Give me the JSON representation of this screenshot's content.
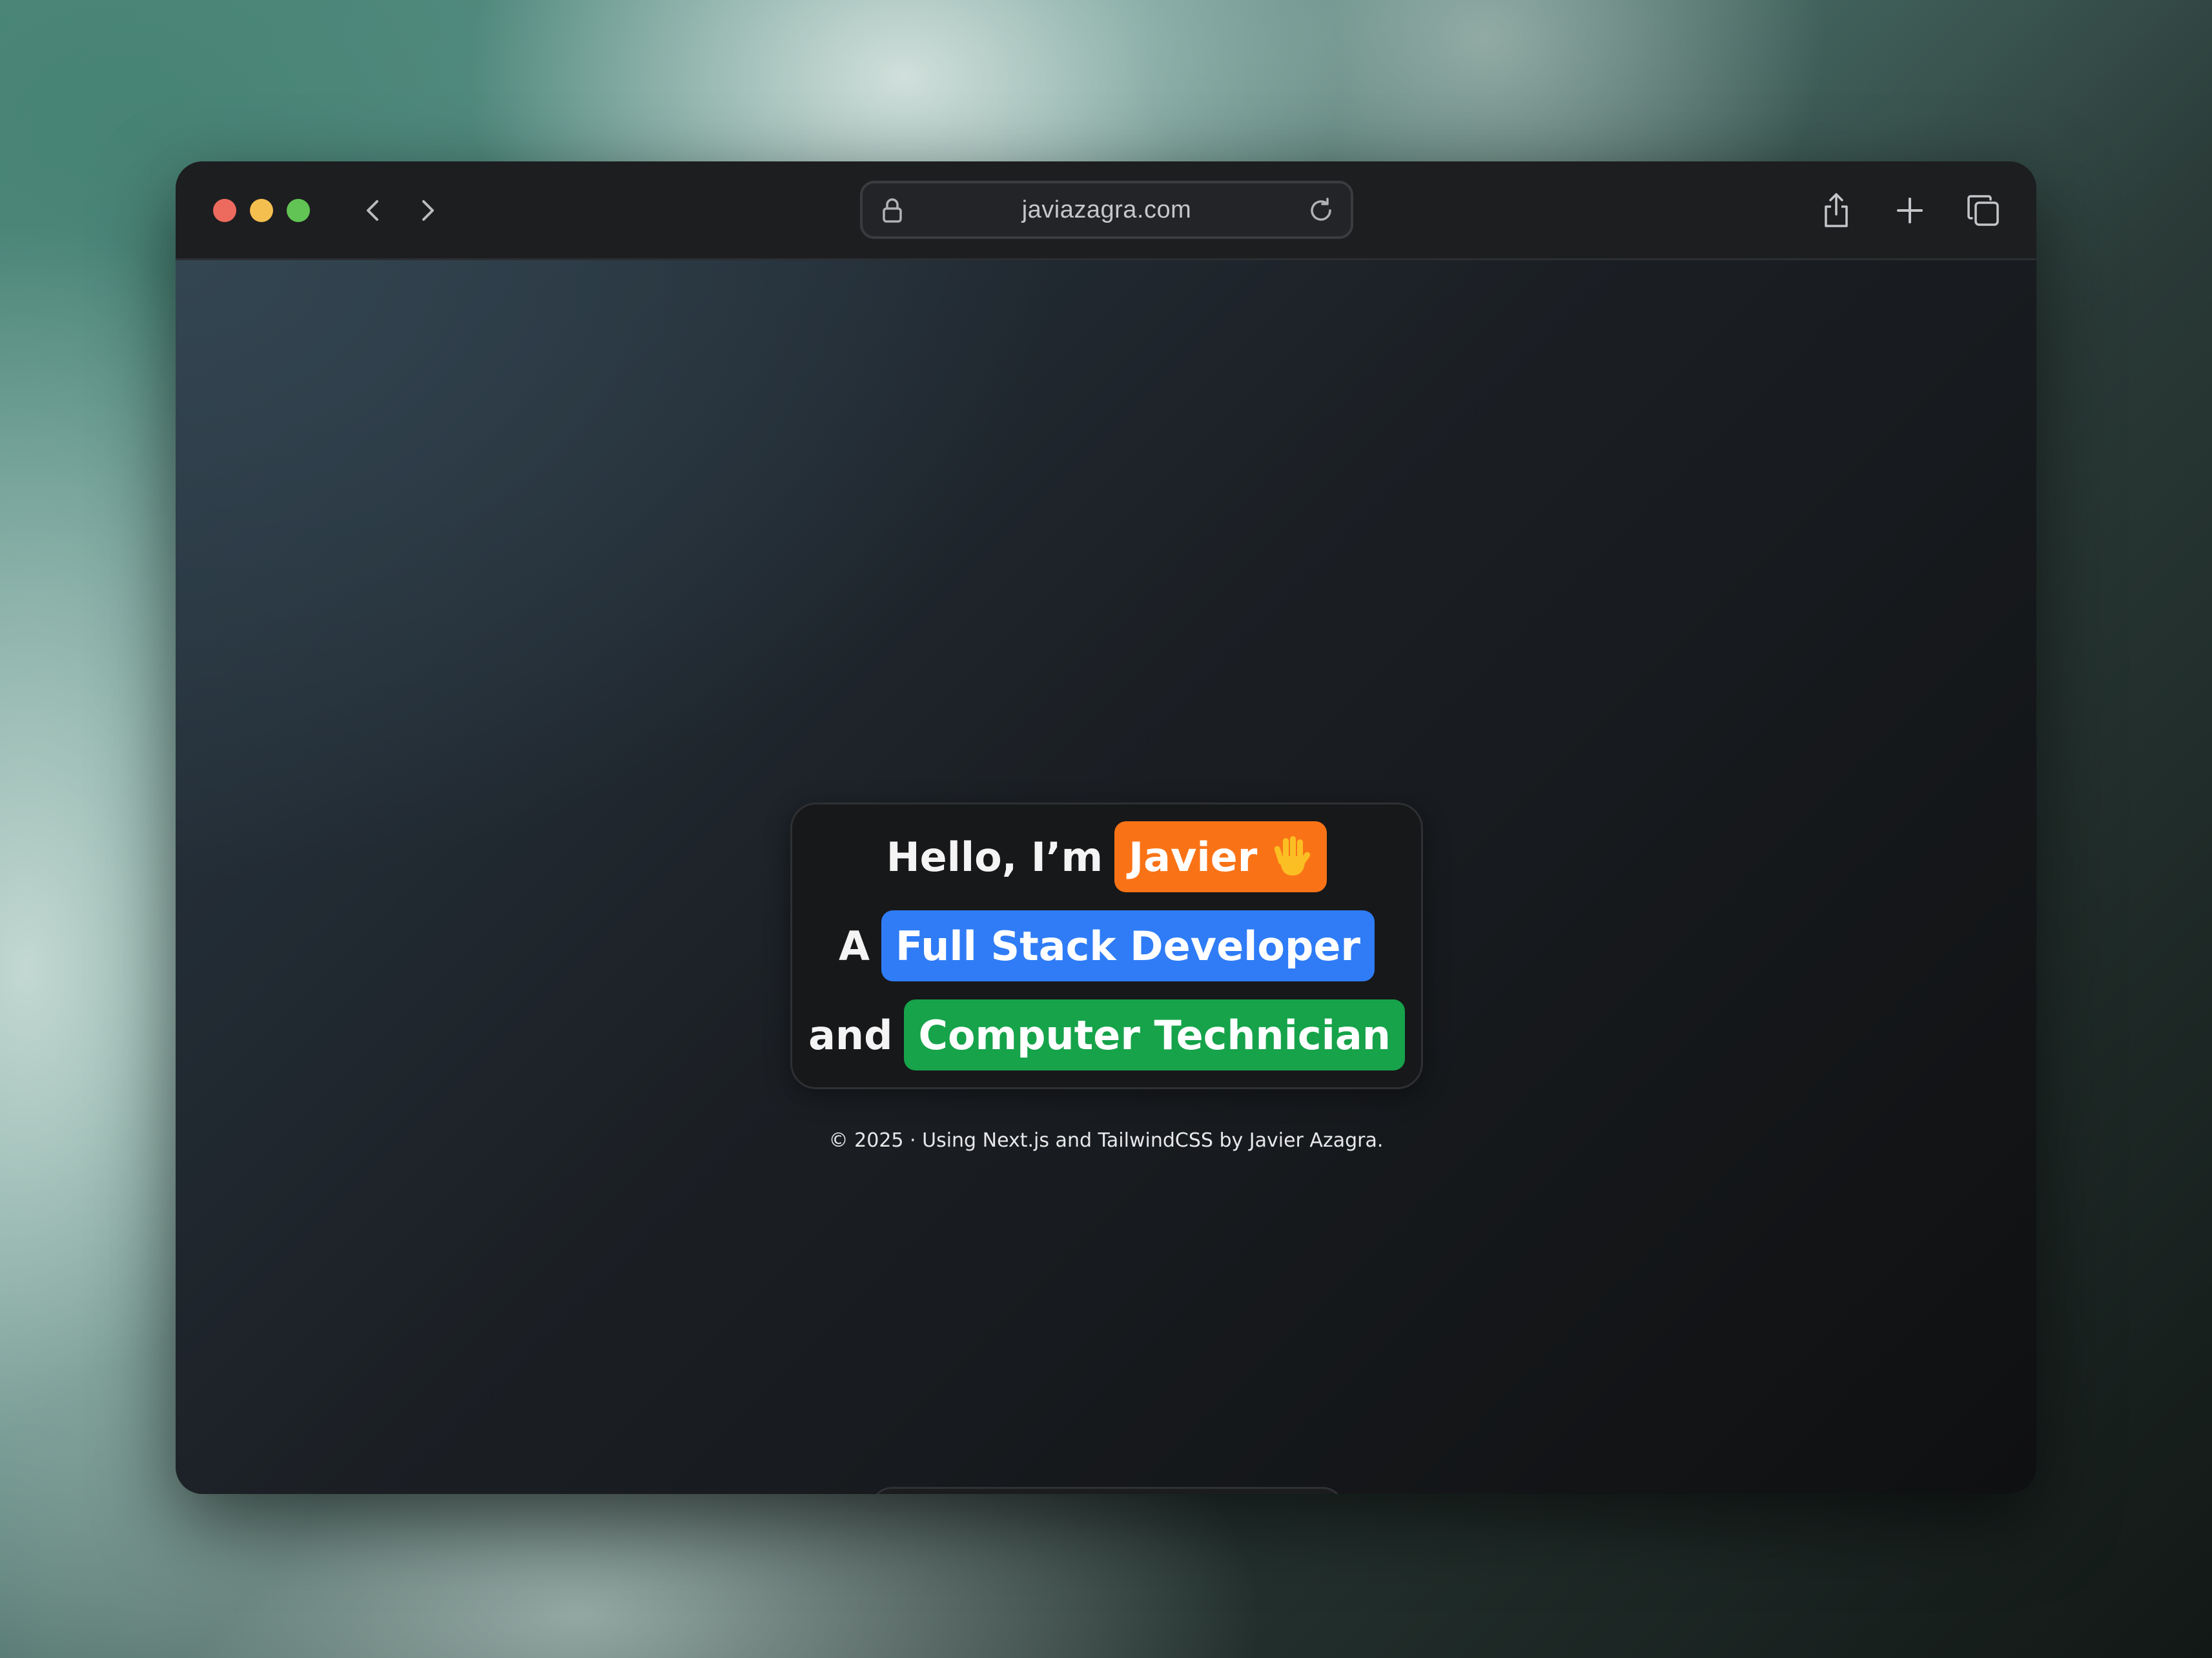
{
  "browser": {
    "url": "javiazagra.com",
    "traffic_lights": {
      "close_color": "#ed6a5e",
      "minimize_color": "#f5bf4f",
      "maximize_color": "#61c454"
    },
    "icons": {
      "back": "chevron-left-icon",
      "forward": "chevron-right-icon",
      "lock": "lock-icon",
      "reload": "reload-icon",
      "share": "share-icon",
      "new_tab": "plus-icon",
      "tabs": "tabs-overview-icon"
    }
  },
  "hero": {
    "line1": {
      "prefix": "Hello, I’m",
      "highlight": "Javier",
      "emoji_icon": "waving-hand-icon",
      "highlight_color": "#f97316"
    },
    "line2": {
      "prefix": "A",
      "highlight": "Full Stack Developer",
      "highlight_color": "#2f7cf6"
    },
    "line3": {
      "prefix": "and",
      "highlight": "Computer Technician",
      "highlight_color": "#16a34a"
    }
  },
  "footer": {
    "text": "© 2025 · Using Next.js and TailwindCSS by Javier Azagra."
  },
  "dock": {
    "accent_color": "#f59512",
    "items": [
      {
        "icon": "home-icon",
        "active": true
      },
      {
        "icon": "pencil-icon",
        "active": false
      },
      {
        "icon": "user-icon",
        "active": false
      },
      {
        "icon": "github-icon",
        "active": false
      },
      {
        "icon": "linkedin-icon",
        "active": false
      },
      {
        "icon": "mail-icon",
        "active": false
      }
    ]
  }
}
